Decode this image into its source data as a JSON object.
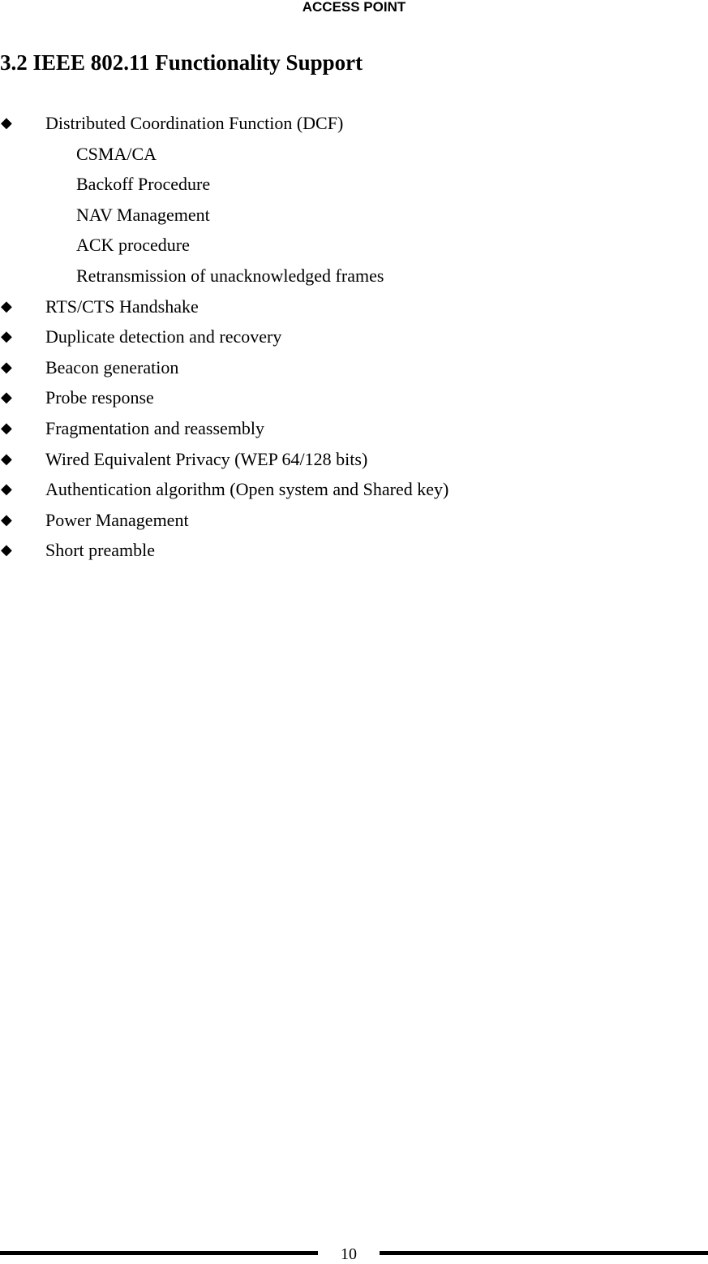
{
  "header": {
    "running_title": "ACCESS POINT"
  },
  "section": {
    "title": "3.2 IEEE 802.11 Functionality Support",
    "bullet_icon": "black-diamond",
    "items": [
      {
        "text": "Distributed Coordination Function (DCF)",
        "level": 1
      },
      {
        "text": "CSMA/CA",
        "level": 2
      },
      {
        "text": "Backoff Procedure",
        "level": 2
      },
      {
        "text": "NAV Management",
        "level": 2
      },
      {
        "text": "ACK procedure",
        "level": 2
      },
      {
        "text": "Retransmission of unacknowledged frames",
        "level": 2
      },
      {
        "text": "RTS/CTS Handshake",
        "level": 1
      },
      {
        "text": "Duplicate detection and recovery",
        "level": 1
      },
      {
        "text": "Beacon generation",
        "level": 1
      },
      {
        "text": "Probe response",
        "level": 1
      },
      {
        "text": "Fragmentation and reassembly",
        "level": 1
      },
      {
        "text": "Wired Equivalent Privacy (WEP 64/128 bits)",
        "level": 1
      },
      {
        "text": "Authentication algorithm (Open system and Shared key)",
        "level": 1
      },
      {
        "text": "Power Management",
        "level": 1
      },
      {
        "text": "Short preamble",
        "level": 1
      }
    ]
  },
  "footer": {
    "page_number": "10"
  }
}
